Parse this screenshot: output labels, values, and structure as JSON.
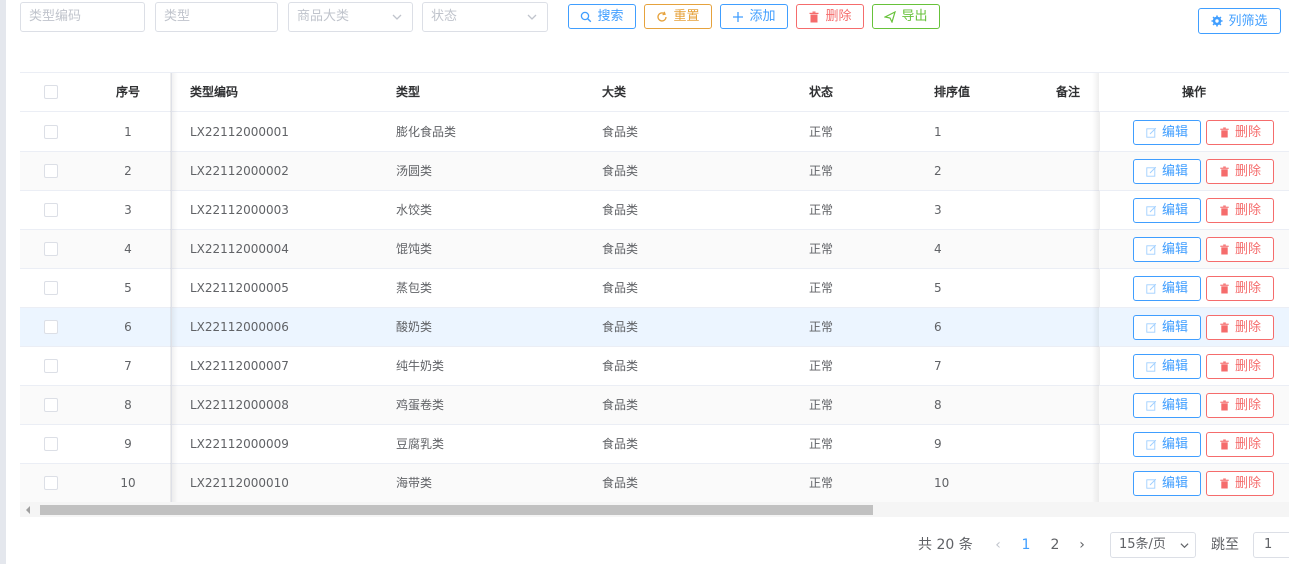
{
  "filters": {
    "type_code_placeholder": "类型编码",
    "type_placeholder": "类型",
    "category_placeholder": "商品大类",
    "status_placeholder": "状态"
  },
  "toolbar": {
    "search": "搜索",
    "reset": "重置",
    "add": "添加",
    "delete": "删除",
    "export": "导出",
    "column_filter": "列筛选"
  },
  "table": {
    "headers": {
      "index": "序号",
      "type_code": "类型编码",
      "type": "类型",
      "category": "大类",
      "status": "状态",
      "sort": "排序值",
      "remark": "备注",
      "actions": "操作"
    },
    "edit_label": "编辑",
    "delete_label": "删除",
    "rows": [
      {
        "index": "1",
        "code": "LX22112000001",
        "type": "膨化食品类",
        "category": "食品类",
        "status": "正常",
        "sort": "1",
        "remark": ""
      },
      {
        "index": "2",
        "code": "LX22112000002",
        "type": "汤圆类",
        "category": "食品类",
        "status": "正常",
        "sort": "2",
        "remark": ""
      },
      {
        "index": "3",
        "code": "LX22112000003",
        "type": "水饺类",
        "category": "食品类",
        "status": "正常",
        "sort": "3",
        "remark": ""
      },
      {
        "index": "4",
        "code": "LX22112000004",
        "type": "馄饨类",
        "category": "食品类",
        "status": "正常",
        "sort": "4",
        "remark": ""
      },
      {
        "index": "5",
        "code": "LX22112000005",
        "type": "蒸包类",
        "category": "食品类",
        "status": "正常",
        "sort": "5",
        "remark": ""
      },
      {
        "index": "6",
        "code": "LX22112000006",
        "type": "酸奶类",
        "category": "食品类",
        "status": "正常",
        "sort": "6",
        "remark": ""
      },
      {
        "index": "7",
        "code": "LX22112000007",
        "type": "纯牛奶类",
        "category": "食品类",
        "status": "正常",
        "sort": "7",
        "remark": ""
      },
      {
        "index": "8",
        "code": "LX22112000008",
        "type": "鸡蛋卷类",
        "category": "食品类",
        "status": "正常",
        "sort": "8",
        "remark": ""
      },
      {
        "index": "9",
        "code": "LX22112000009",
        "type": "豆腐乳类",
        "category": "食品类",
        "status": "正常",
        "sort": "9",
        "remark": ""
      },
      {
        "index": "10",
        "code": "LX22112000010",
        "type": "海带类",
        "category": "食品类",
        "status": "正常",
        "sort": "10",
        "remark": ""
      }
    ]
  },
  "pagination": {
    "total": "共 20 条",
    "pages": [
      "1",
      "2"
    ],
    "current": "1",
    "page_size": "15条/页",
    "jump_label": "跳至",
    "jump_value": "1"
  },
  "colors": {
    "primary": "#409eff",
    "warning": "#e6a23c",
    "danger": "#f56c6c",
    "success": "#67c23a",
    "row_hover": "#ecf5ff"
  }
}
